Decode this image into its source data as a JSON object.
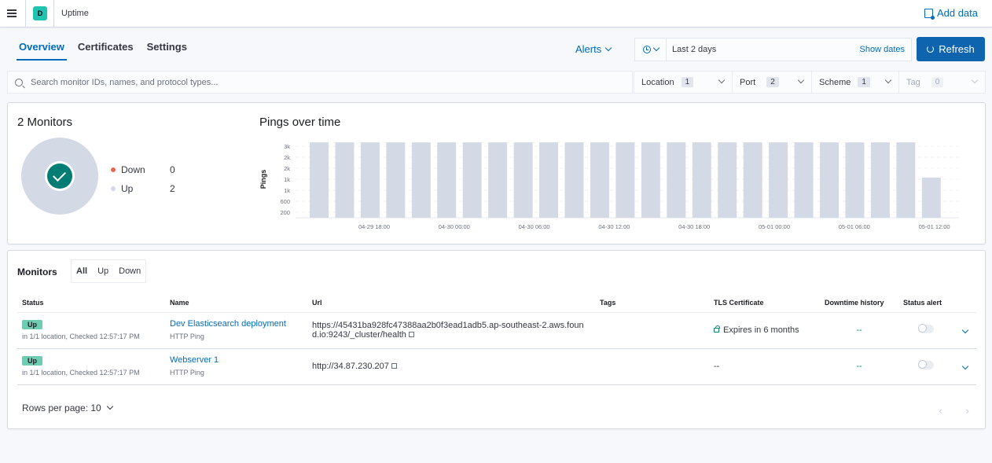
{
  "header": {
    "space_initial": "D",
    "app_title": "Uptime",
    "add_data_label": "Add data"
  },
  "tabs": [
    {
      "label": "Overview",
      "active": true
    },
    {
      "label": "Certificates",
      "active": false
    },
    {
      "label": "Settings",
      "active": false
    }
  ],
  "toolbar": {
    "alerts_label": "Alerts",
    "date_range": "Last 2 days",
    "show_dates_label": "Show dates",
    "refresh_label": "Refresh"
  },
  "search": {
    "placeholder": "Search monitor IDs, names, and protocol types...",
    "value": ""
  },
  "filters": [
    {
      "label": "Location",
      "count": "1",
      "disabled": false
    },
    {
      "label": "Port",
      "count": "2",
      "disabled": false
    },
    {
      "label": "Scheme",
      "count": "1",
      "disabled": false
    },
    {
      "label": "Tag",
      "count": "0",
      "disabled": true
    }
  ],
  "snapshot": {
    "title": "2 Monitors",
    "legend": [
      {
        "label": "Down",
        "value": "0",
        "color": "#e7664c"
      },
      {
        "label": "Up",
        "value": "2",
        "color": "#d3dae6"
      }
    ]
  },
  "pings": {
    "title": "Pings over time"
  },
  "chart_data": {
    "type": "bar",
    "title": "Pings over time",
    "xlabel": "",
    "ylabel": "Pings",
    "y_ticks": [
      200,
      600,
      1000,
      1400,
      1800,
      2200,
      2600
    ],
    "y_tick_labels": [
      "200",
      "600",
      "1k",
      "1k",
      "2k",
      "2k",
      "3k"
    ],
    "ylim": [
      0,
      2800
    ],
    "x_tick_labels": [
      "04-29 18:00",
      "04-30 00:00",
      "04-30 06:00",
      "04-30 12:00",
      "04-30 18:00",
      "05-01 00:00",
      "05-01 06:00",
      "05-01 12:00"
    ],
    "grid": true,
    "series": [
      {
        "name": "Up",
        "color": "#d3dae6",
        "values": [
          2740,
          2740,
          2740,
          2740,
          2740,
          2740,
          2740,
          2740,
          2740,
          2740,
          2740,
          2740,
          2740,
          2740,
          2740,
          2740,
          2740,
          2740,
          2740,
          2740,
          2740,
          2740,
          2740,
          2740,
          1460
        ]
      }
    ]
  },
  "monitors": {
    "title": "Monitors",
    "status_filters": [
      {
        "label": "All",
        "active": true
      },
      {
        "label": "Up",
        "active": false
      },
      {
        "label": "Down",
        "active": false
      }
    ],
    "columns": [
      "Status",
      "Name",
      "Url",
      "Tags",
      "TLS Certificate",
      "Downtime history",
      "Status alert"
    ],
    "rows": [
      {
        "status": "Up",
        "status_detail": "in 1/1 location, Checked 12:57:17 PM",
        "name": "Dev Elasticsearch deployment",
        "type": "HTTP Ping",
        "url": "https://45431ba928fc47388aa2b0f3ead1adb5.ap-southeast-2.aws.found.io:9243/_cluster/health",
        "tags": "",
        "tls": "Expires in 6 months",
        "downtime": "--",
        "alert_enabled": false
      },
      {
        "status": "Up",
        "status_detail": "in 1/1 location, Checked 12:57:17 PM",
        "name": "Webserver 1",
        "type": "HTTP Ping",
        "url": "http://34.87.230.207",
        "tags": "",
        "tls": "--",
        "downtime": "--",
        "alert_enabled": false
      }
    ],
    "rows_per_page_label": "Rows per page: 10"
  }
}
